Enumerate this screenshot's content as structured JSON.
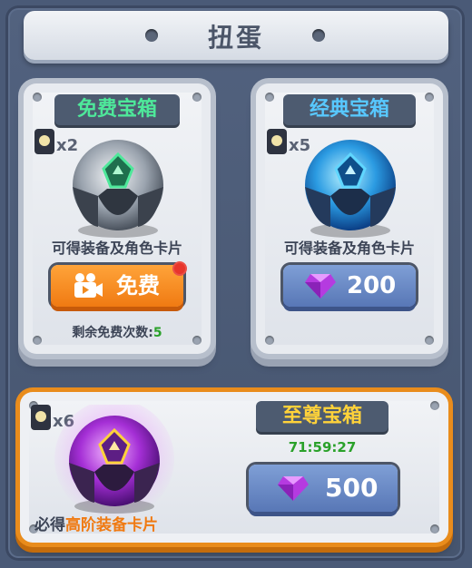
{
  "title": "扭蛋",
  "free_box": {
    "name": "免费宝箱",
    "count": "x2",
    "desc": "可得装备及角色卡片",
    "button_label": "免费",
    "remaining_label": "剩余免费次数:",
    "remaining_value": "5",
    "name_color": "#4ee89a"
  },
  "classic_box": {
    "name": "经典宝箱",
    "count": "x5",
    "desc": "可得装备及角色卡片",
    "price": "200",
    "name_color": "#58c8ff"
  },
  "supreme_box": {
    "name": "至尊宝箱",
    "count": "x6",
    "desc_prefix": "必得",
    "desc_highlight": "高阶装备卡片",
    "timer": "71:59:27",
    "price": "500",
    "name_color": "#ffd23a",
    "highlight_color": "#f07a12"
  }
}
